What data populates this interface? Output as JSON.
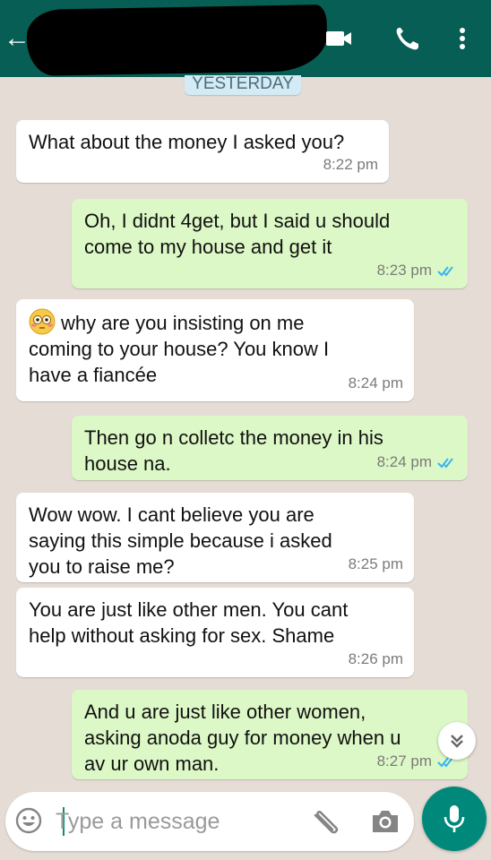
{
  "header": {
    "back_glyph": "←",
    "icons": [
      "back-icon",
      "video-call-icon",
      "voice-call-icon",
      "more-options-icon"
    ]
  },
  "date_divider": "YESTERDAY",
  "messages": [
    {
      "direction": "incoming",
      "text": "What about the money I asked you?",
      "time": "8:22 pm"
    },
    {
      "direction": "outgoing",
      "text": "Oh, I didnt 4get, but I said u should\ncome to my house and get it",
      "time": "8:23 pm",
      "status": "read"
    },
    {
      "direction": "incoming",
      "emoji": "flushed-face",
      "text": "why are you insisting on me\ncoming to your house? You know I\nhave a fiancée",
      "time": "8:24 pm"
    },
    {
      "direction": "outgoing",
      "text": "Then go n colletc the money in his\nhouse na.",
      "time": "8:24 pm",
      "status": "read"
    },
    {
      "direction": "incoming",
      "text": "Wow wow. I cant believe you are\nsaying this simple because i asked\nyou to raise me?",
      "time": "8:25 pm"
    },
    {
      "direction": "incoming",
      "text": "You are just like other men. You cant\nhelp without asking for sex.  Shame",
      "time": "8:26 pm"
    },
    {
      "direction": "outgoing",
      "text": "And u are just like other women,\nasking anoda guy for money when u\nav ur own man.",
      "time": "8:27 pm",
      "status": "read"
    }
  ],
  "composer": {
    "placeholder": "Type a message",
    "value": ""
  },
  "colors": {
    "header": "#075e54",
    "outgoing_bubble": "#dcf8c6",
    "incoming_bubble": "#ffffff",
    "read_ticks": "#34b7f1",
    "mic_button": "#00897b"
  }
}
